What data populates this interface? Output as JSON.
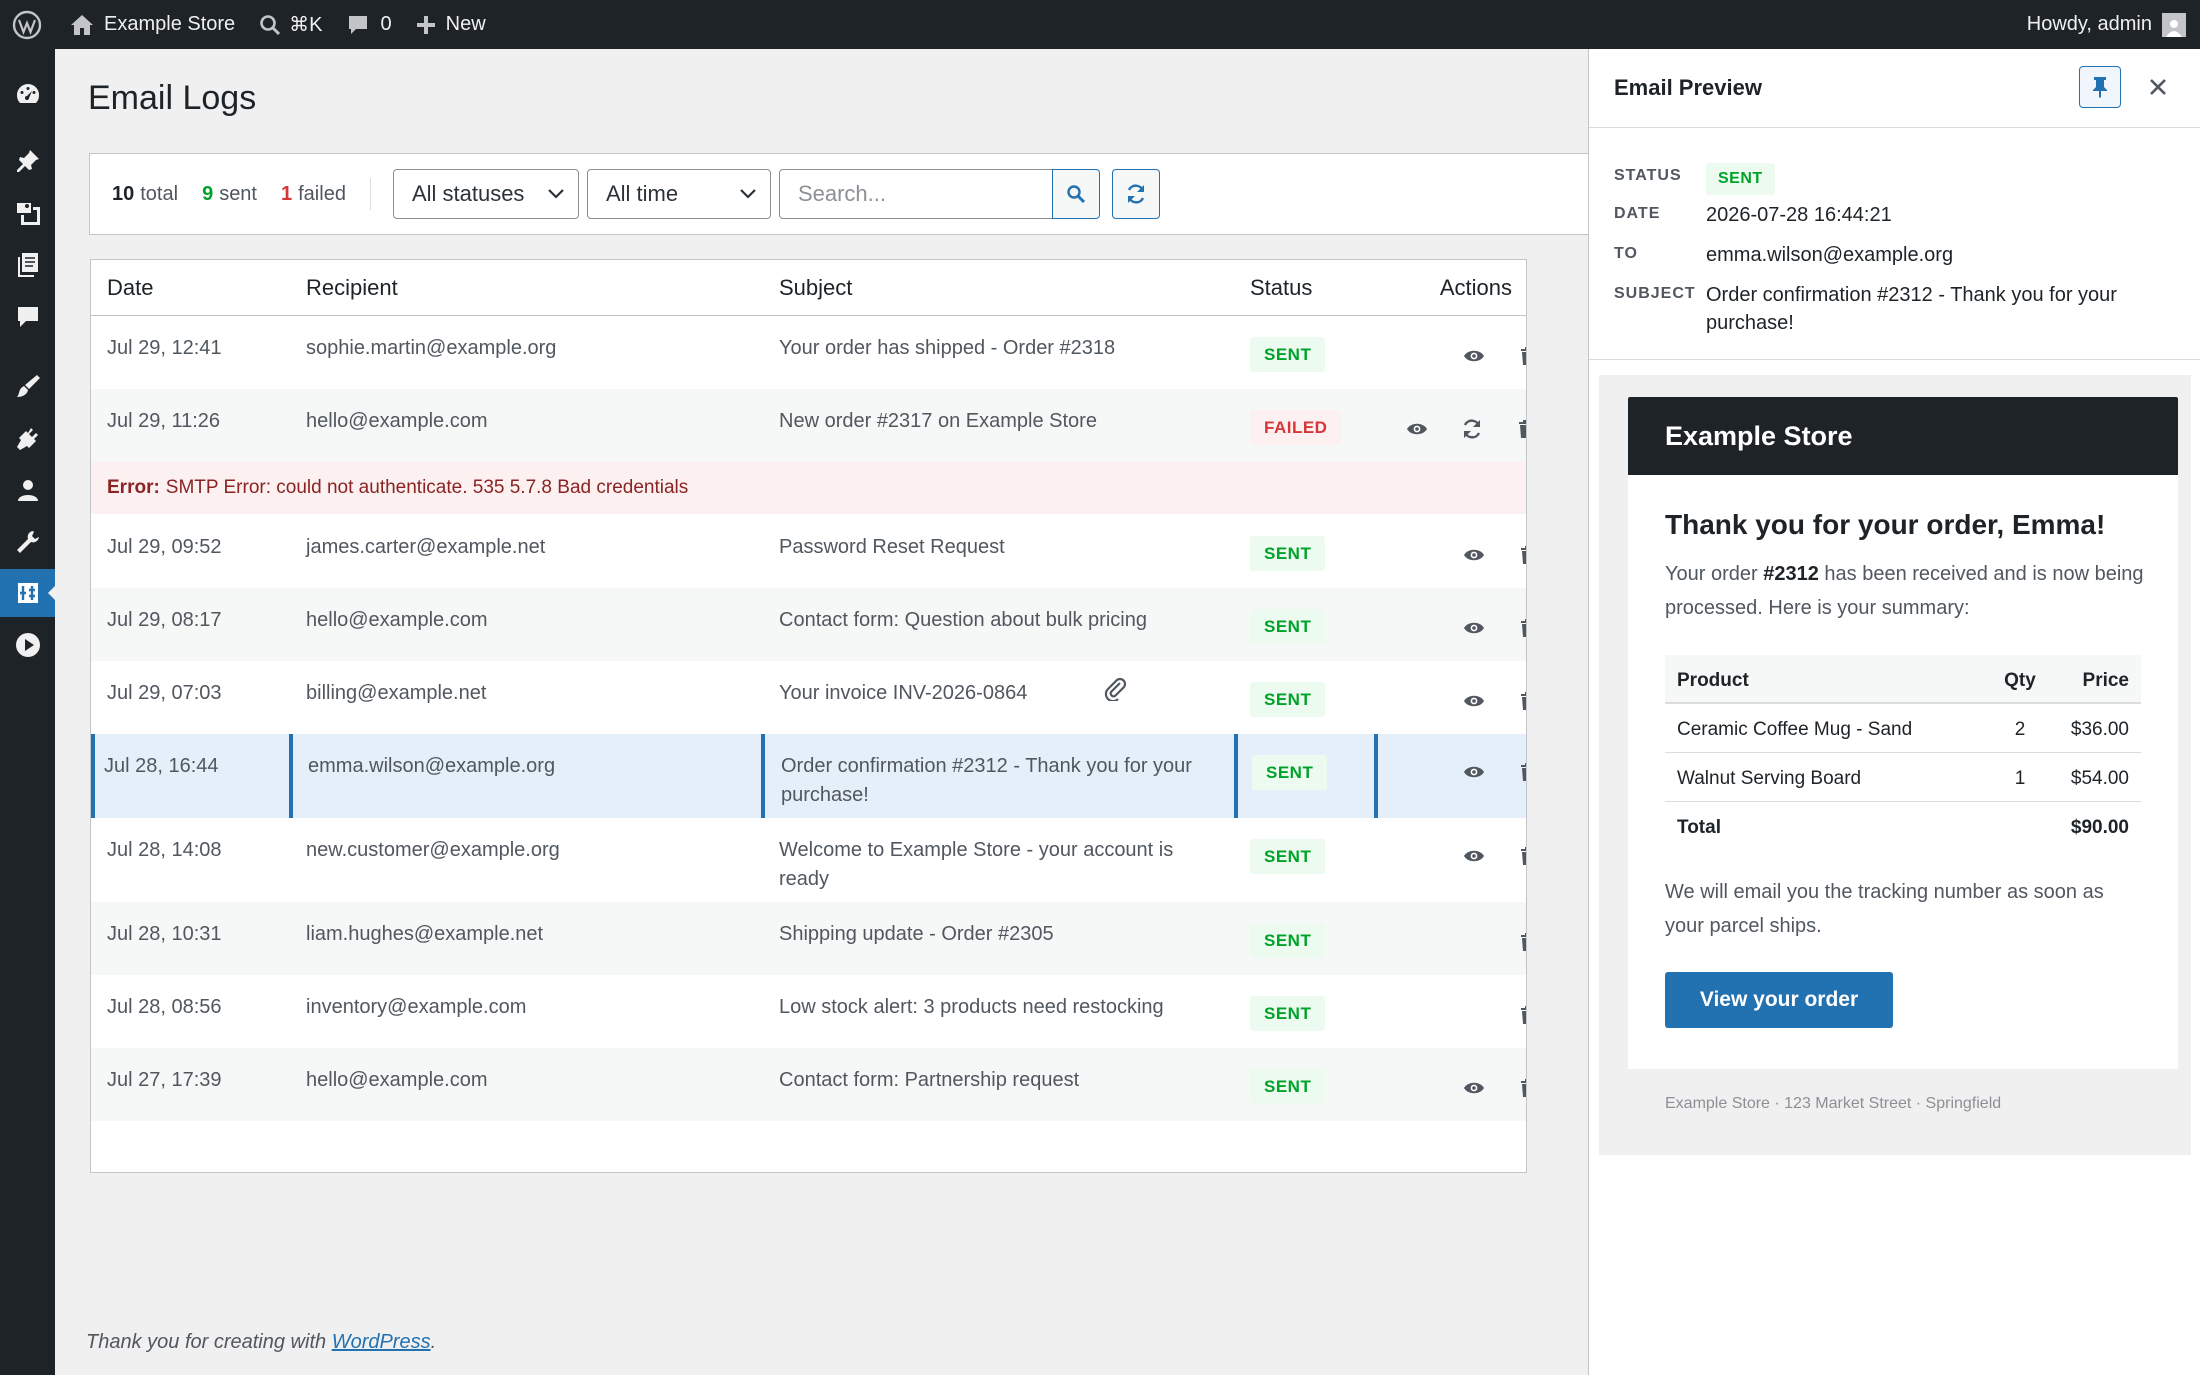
{
  "admin_bar": {
    "site_name": "Example Store",
    "shortcut": "⌘K",
    "comments_count": "0",
    "new_label": "New",
    "greeting": "Howdy, admin"
  },
  "page": {
    "title": "Email Logs",
    "footer_text": "Thank you for creating with ",
    "footer_link": "WordPress",
    "footer_end": "."
  },
  "toolbar": {
    "total_count": "10",
    "total_label": "total",
    "sent_count": "9",
    "sent_label": "sent",
    "failed_count": "1",
    "failed_label": "failed",
    "status_select": "All statuses",
    "time_select": "All time",
    "search_placeholder": "Search..."
  },
  "table": {
    "headers": {
      "date": "Date",
      "recipient": "Recipient",
      "subject": "Subject",
      "status": "Status",
      "actions": "Actions"
    },
    "rows": [
      {
        "date": "Jul 29, 12:41",
        "recipient": "sophie.martin@example.org",
        "subject": "Your order has shipped - Order #2318",
        "status": "SENT"
      },
      {
        "date": "Jul 29, 11:26",
        "recipient": "hello@example.com",
        "subject": "New order #2317 on Example Store",
        "status": "FAILED"
      },
      {
        "date": "Jul 29, 09:52",
        "recipient": "james.carter@example.net",
        "subject": "Password Reset Request",
        "status": "SENT"
      },
      {
        "date": "Jul 29, 08:17",
        "recipient": "hello@example.com",
        "subject": "Contact form: Question about bulk pricing",
        "status": "SENT"
      },
      {
        "date": "Jul 29, 07:03",
        "recipient": "billing@example.net",
        "subject": "Your invoice INV-2026-0864",
        "status": "SENT"
      },
      {
        "date": "Jul 28, 16:44",
        "recipient": "emma.wilson@example.org",
        "subject": "Order confirmation #2312 - Thank you for your purchase!",
        "status": "SENT"
      },
      {
        "date": "Jul 28, 14:08",
        "recipient": "new.customer@example.org",
        "subject": "Welcome to Example Store - your account is ready",
        "status": "SENT"
      },
      {
        "date": "Jul 28, 10:31",
        "recipient": "liam.hughes@example.net",
        "subject": "Shipping update - Order #2305",
        "status": "SENT"
      },
      {
        "date": "Jul 28, 08:56",
        "recipient": "inventory@example.com",
        "subject": "Low stock alert: 3 products need restocking",
        "status": "SENT"
      },
      {
        "date": "Jul 27, 17:39",
        "recipient": "hello@example.com",
        "subject": "Contact form: Partnership request",
        "status": "SENT"
      }
    ],
    "error_label": "Error:",
    "error_message": "SMTP Error: could not authenticate. 535 5.7.8 Bad credentials"
  },
  "preview": {
    "title": "Email Preview",
    "status_label": "STATUS",
    "status_value": "SENT",
    "date_label": "DATE",
    "date_value": "2026-07-28 16:44:21",
    "to_label": "TO",
    "to_value": "emma.wilson@example.org",
    "subject_label": "SUBJECT",
    "subject_value": "Order confirmation #2312 - Thank you for your purchase!",
    "email": {
      "store_name": "Example Store",
      "heading": "Thank you for your order, Emma!",
      "intro_before": "Your order ",
      "order_number": "#2312",
      "intro_after": " has been received and is now being processed. Here is your summary:",
      "table_headers": {
        "product": "Product",
        "qty": "Qty",
        "price": "Price"
      },
      "items": [
        {
          "product": "Ceramic Coffee Mug - Sand",
          "qty": "2",
          "price": "$36.00"
        },
        {
          "product": "Walnut Serving Board",
          "qty": "1",
          "price": "$54.00"
        }
      ],
      "total_label": "Total",
      "total_value": "$90.00",
      "tracking_note": "We will email you the tracking number as soon as your parcel ships.",
      "button_label": "View your order",
      "footer": "Example Store · 123 Market Street · Springfield"
    }
  },
  "colors": {
    "accent": "#2271b1",
    "admin_bar": "#1d2327",
    "sent": "#00a32a",
    "failed": "#d63638"
  },
  "icons": {
    "view": "eye-icon",
    "delete": "trash-icon",
    "resend": "refresh-icon",
    "attachment": "paperclip-icon"
  }
}
